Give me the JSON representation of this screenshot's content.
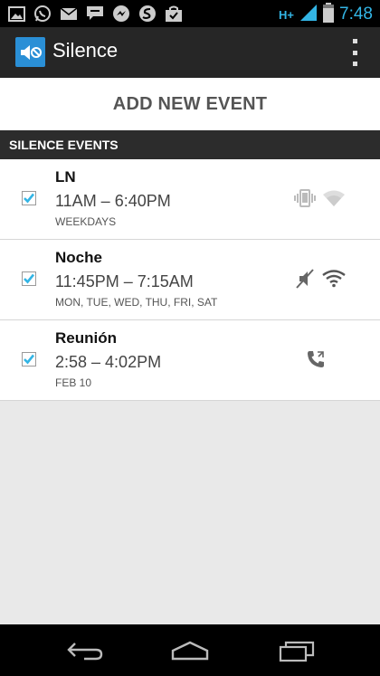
{
  "status_bar": {
    "time": "7:48",
    "notification_icons": [
      "image-icon",
      "whatsapp-icon",
      "gmail-icon",
      "talk-icon",
      "messenger-icon",
      "swype-icon",
      "market-icon"
    ],
    "network": "H+"
  },
  "action_bar": {
    "title": "Silence",
    "overflow_icon": "overflow-menu-icon"
  },
  "add_event_label": "ADD NEW EVENT",
  "section_header": "SILENCE EVENTS",
  "events": [
    {
      "name": "LN",
      "time": "11AM – 6:40PM",
      "days": "WEEKDAYS",
      "checked": true,
      "icons": [
        "vibrate-icon",
        "wifi-icon"
      ]
    },
    {
      "name": "Noche",
      "time": "11:45PM – 7:15AM",
      "days": "MON, TUE, WED, THU, FRI, SAT",
      "checked": true,
      "icons": [
        "mute-icon",
        "wifi-icon"
      ]
    },
    {
      "name": "Reunión",
      "time": "2:58 – 4:02PM",
      "days": "FEB 10",
      "checked": true,
      "icons": [
        "phone-icon"
      ]
    }
  ],
  "nav_bar": {
    "buttons": [
      "back-icon",
      "home-icon",
      "recent-apps-icon"
    ]
  },
  "colors": {
    "accent": "#33b5e5",
    "app_icon": "#2a8fd6",
    "action_bar": "#262626",
    "section_header": "#2c2c2c",
    "background": "#e9e9e9"
  }
}
